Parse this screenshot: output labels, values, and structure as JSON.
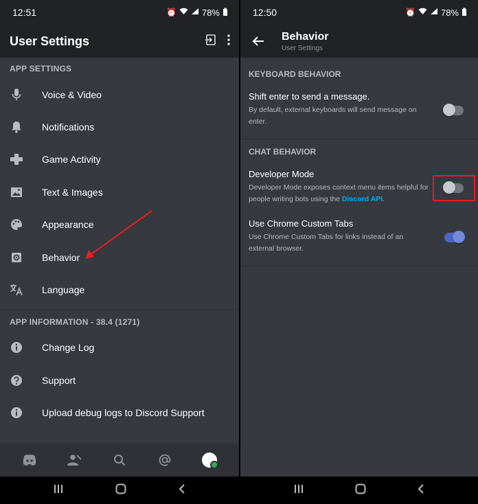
{
  "left": {
    "status": {
      "time": "12:51",
      "battery": "78%"
    },
    "header": {
      "title": "User Settings"
    },
    "app_settings": {
      "label": "APP SETTINGS",
      "items": [
        {
          "label": "Voice & Video",
          "icon": "mic-icon"
        },
        {
          "label": "Notifications",
          "icon": "bell-icon"
        },
        {
          "label": "Game Activity",
          "icon": "gamepad-icon"
        },
        {
          "label": "Text & Images",
          "icon": "image-icon"
        },
        {
          "label": "Appearance",
          "icon": "palette-icon"
        },
        {
          "label": "Behavior",
          "icon": "gear-icon"
        },
        {
          "label": "Language",
          "icon": "translate-icon"
        }
      ]
    },
    "app_info": {
      "label": "APP INFORMATION - 38.4 (1271)",
      "items": [
        {
          "label": "Change Log",
          "icon": "info-icon"
        },
        {
          "label": "Support",
          "icon": "help-icon"
        },
        {
          "label": "Upload debug logs to Discord Support",
          "icon": "info-icon"
        }
      ]
    }
  },
  "right": {
    "status": {
      "time": "12:50",
      "battery": "78%"
    },
    "header": {
      "title": "Behavior",
      "subtitle": "User Settings"
    },
    "keyboard": {
      "label": "KEYBOARD BEHAVIOR",
      "shift_enter": {
        "title": "Shift enter to send a message.",
        "desc": "By default, external keyboards will send message on enter.",
        "enabled": false
      }
    },
    "chat": {
      "label": "CHAT BEHAVIOR",
      "developer_mode": {
        "title": "Developer Mode",
        "desc": "Developer Mode exposes context menu items helpful for people writing bots using the ",
        "link": "Discord API",
        "desc_end": ".",
        "enabled": false
      },
      "chrome_tabs": {
        "title": "Use Chrome Custom Tabs",
        "desc": "Use Chrome Custom Tabs for links instead of an external browser.",
        "enabled": true
      }
    }
  },
  "colors": {
    "background": "#36393f",
    "header": "#202225",
    "accent": "#7289da",
    "link": "#00aff4",
    "highlight": "#e32020",
    "annotation_arrow": "#e32020"
  }
}
